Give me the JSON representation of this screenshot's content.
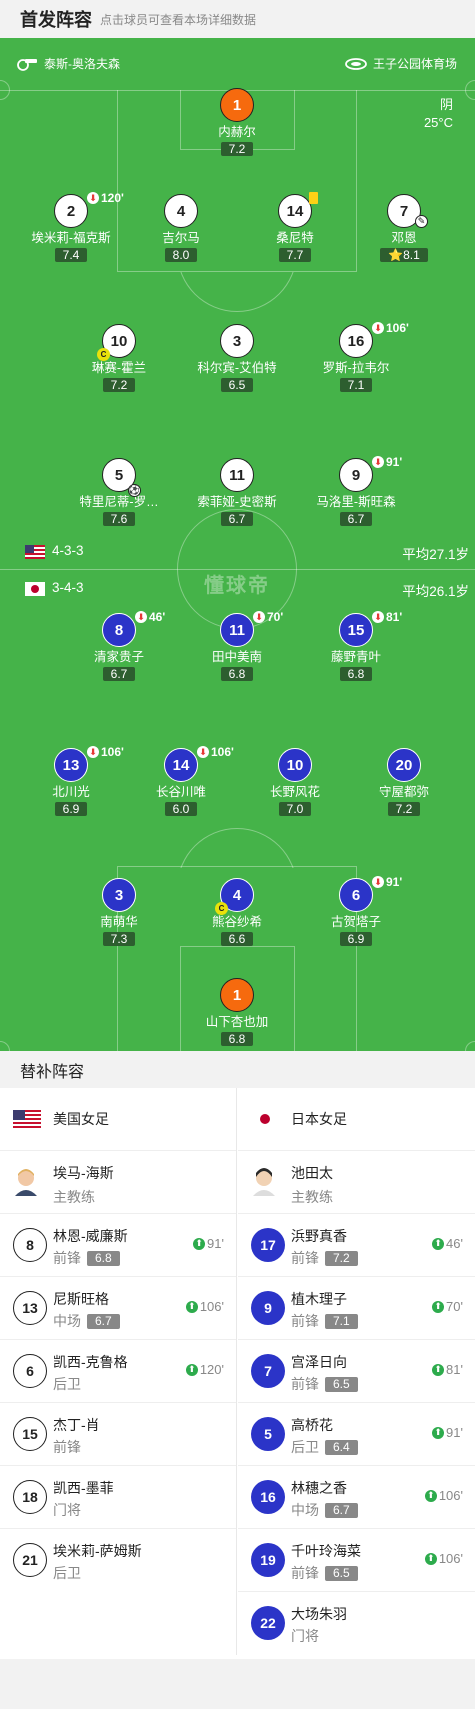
{
  "header": {
    "title": "首发阵容",
    "subtitle": "点击球员可查看本场详细数据"
  },
  "venue": {
    "referee": "泰斯-奥洛夫森",
    "stadium": "王子公园体育场"
  },
  "weather": {
    "condition": "阴",
    "temperature": "25°C"
  },
  "watermark": "懂球帝",
  "teams": {
    "usa": {
      "formation": "4-3-3",
      "avg_age": "平均27.1岁"
    },
    "japan": {
      "formation": "3-4-3",
      "avg_age": "平均26.1岁"
    }
  },
  "usa_players": [
    {
      "number": "1",
      "name": "内赫尔",
      "rating": "7.2"
    },
    {
      "number": "2",
      "name": "埃米莉-福克斯",
      "rating": "7.4",
      "sub_time": "120'"
    },
    {
      "number": "4",
      "name": "吉尔马",
      "rating": "8.0"
    },
    {
      "number": "14",
      "name": "桑尼特",
      "rating": "7.7"
    },
    {
      "number": "7",
      "name": "邓恩",
      "rating": "8.1"
    },
    {
      "number": "10",
      "name": "琳赛-霍兰",
      "rating": "7.2",
      "captain": "C"
    },
    {
      "number": "3",
      "name": "科尔宾-艾伯特",
      "rating": "6.5"
    },
    {
      "number": "16",
      "name": "罗斯-拉韦尔",
      "rating": "7.1",
      "sub_time": "106'"
    },
    {
      "number": "5",
      "name": "特里尼蒂-罗…",
      "rating": "7.6"
    },
    {
      "number": "11",
      "name": "索菲娅-史密斯",
      "rating": "6.7"
    },
    {
      "number": "9",
      "name": "马洛里-斯旺森",
      "rating": "6.7",
      "sub_time": "91'"
    }
  ],
  "japan_players": [
    {
      "number": "8",
      "name": "清家贵子",
      "rating": "6.7",
      "sub_time": "46'"
    },
    {
      "number": "11",
      "name": "田中美南",
      "rating": "6.8",
      "sub_time": "70'"
    },
    {
      "number": "15",
      "name": "藤野青叶",
      "rating": "6.8",
      "sub_time": "81'"
    },
    {
      "number": "13",
      "name": "北川光",
      "rating": "6.9",
      "sub_time": "106'"
    },
    {
      "number": "14",
      "name": "长谷川唯",
      "rating": "6.0",
      "sub_time": "106'"
    },
    {
      "number": "10",
      "name": "长野风花",
      "rating": "7.0"
    },
    {
      "number": "20",
      "name": "守屋都弥",
      "rating": "7.2"
    },
    {
      "number": "3",
      "name": "南萌华",
      "rating": "7.3"
    },
    {
      "number": "4",
      "name": "熊谷纱希",
      "rating": "6.6",
      "captain": "C"
    },
    {
      "number": "6",
      "name": "古贺塔子",
      "rating": "6.9",
      "sub_time": "91'"
    },
    {
      "number": "1",
      "name": "山下杏也加",
      "rating": "6.8"
    }
  ],
  "substitutes": {
    "title": "替补阵容",
    "left": {
      "team_name": "美国女足",
      "coach": {
        "name": "埃马-海斯",
        "role": "主教练"
      },
      "players": [
        {
          "number": "8",
          "name": "林恩-威廉斯",
          "position": "前锋",
          "rating": "6.8",
          "time": "91'"
        },
        {
          "number": "13",
          "name": "尼斯旺格",
          "position": "中场",
          "rating": "6.7",
          "time": "106'"
        },
        {
          "number": "6",
          "name": "凯西-克鲁格",
          "position": "后卫",
          "rating": "",
          "time": "120'"
        },
        {
          "number": "15",
          "name": "杰丁-肖",
          "position": "前锋",
          "rating": "",
          "time": ""
        },
        {
          "number": "18",
          "name": "凯西-墨菲",
          "position": "门将",
          "rating": "",
          "time": ""
        },
        {
          "number": "21",
          "name": "埃米莉-萨姆斯",
          "position": "后卫",
          "rating": "",
          "time": ""
        }
      ]
    },
    "right": {
      "team_name": "日本女足",
      "coach": {
        "name": "池田太",
        "role": "主教练"
      },
      "players": [
        {
          "number": "17",
          "name": "浜野真香",
          "position": "前锋",
          "rating": "7.2",
          "time": "46'"
        },
        {
          "number": "9",
          "name": "植木理子",
          "position": "前锋",
          "rating": "7.1",
          "time": "70'"
        },
        {
          "number": "7",
          "name": "宫泽日向",
          "position": "前锋",
          "rating": "6.5",
          "time": "81'"
        },
        {
          "number": "5",
          "name": "高桥花",
          "position": "后卫",
          "rating": "6.4",
          "time": "91'"
        },
        {
          "number": "16",
          "name": "林穗之香",
          "position": "中场",
          "rating": "6.7",
          "time": "106'"
        },
        {
          "number": "19",
          "name": "千叶玲海菜",
          "position": "前锋",
          "rating": "6.5",
          "time": "106'"
        },
        {
          "number": "22",
          "name": "大场朱羽",
          "position": "门将",
          "rating": "",
          "time": ""
        }
      ]
    }
  },
  "colors": {
    "pitch": "#45b349",
    "japan_blue": "#2b34c8",
    "goalkeeper": "#f66a0e",
    "rating_bg": "#2d5e2f"
  }
}
